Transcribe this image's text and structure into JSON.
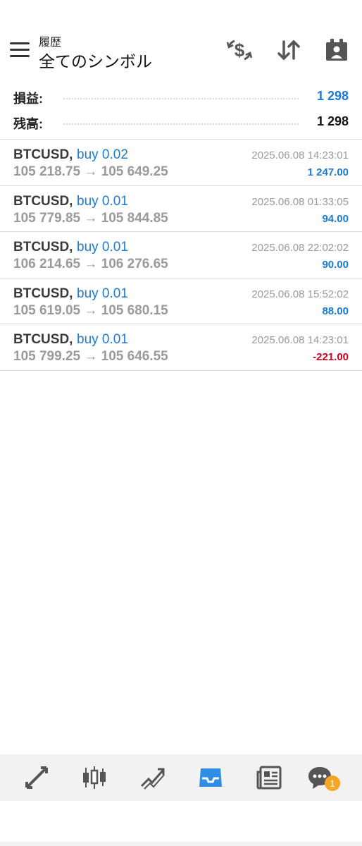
{
  "header": {
    "subtitle": "履歴",
    "title": "全てのシンボル",
    "icons": [
      "menu-icon",
      "currency-exchange-icon",
      "sort-icon",
      "calendar-icon"
    ]
  },
  "summary": {
    "profit_label": "損益:",
    "profit_value": "1 298",
    "balance_label": "残高:",
    "balance_value": "1 298",
    "colors": {
      "profit": "#1a7ad8",
      "balance": "#111111"
    }
  },
  "deals": [
    {
      "symbol": "BTCUSD,",
      "type": "buy 0.02",
      "prices": "105 218.75 → 105 649.25",
      "time": "2025.06.08 14:23:01",
      "profit": "1 247.00",
      "profit_color": "#1a7ad8"
    },
    {
      "symbol": "BTCUSD,",
      "type": "buy 0.01",
      "prices": "105 779.85 → 105 844.85",
      "time": "2025.06.08 01:33:05",
      "profit": "94.00",
      "profit_color": "#1a7ad8"
    },
    {
      "symbol": "BTCUSD,",
      "type": "buy 0.01",
      "prices": "106 214.65 → 106 276.65",
      "time": "2025.06.08 22:02:02",
      "profit": "90.00",
      "profit_color": "#1a7ad8"
    },
    {
      "symbol": "BTCUSD,",
      "type": "buy 0.01",
      "prices": "105 619.05 → 105 680.15",
      "time": "2025.06.08 15:52:02",
      "profit": "88.00",
      "profit_color": "#1a7ad8"
    },
    {
      "symbol": "BTCUSD,",
      "type": "buy 0.01",
      "prices": "105 799.25 → 105 646.55",
      "time": "2025.06.08 14:23:01",
      "profit": "-221.00",
      "profit_color": "#d0021b"
    }
  ],
  "bottom_nav": {
    "items": [
      "quotes-icon",
      "chart-icon",
      "trade-icon",
      "history-icon",
      "news-icon",
      "chat-icon"
    ],
    "active": "history-icon",
    "active_color": "#2e8ee6",
    "chat_badge": "1"
  }
}
